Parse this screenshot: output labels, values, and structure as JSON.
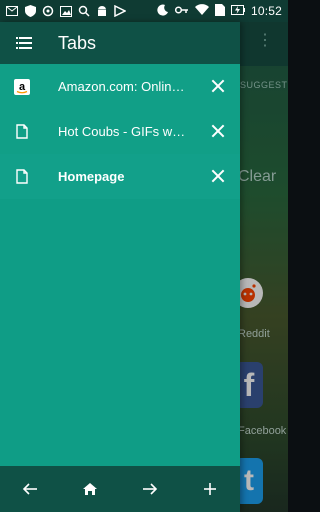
{
  "status_bar": {
    "time": "10:52",
    "icons": [
      "email-icon",
      "shield-icon",
      "sync-icon",
      "image-icon",
      "search-icon",
      "android-icon",
      "flag-icon",
      "moon-icon",
      "key-icon",
      "wifi-icon",
      "sim-icon",
      "battery-charging-icon"
    ]
  },
  "drawer": {
    "title": "Tabs",
    "tabs": [
      {
        "label": "Amazon.com: Online Shopping",
        "icon": "amazon-icon"
      },
      {
        "label": "Hot Coubs - GIFs with Sound",
        "icon": "page-icon"
      },
      {
        "label": "Homepage",
        "icon": "page-icon"
      }
    ],
    "bottom_bar": [
      "back-arrow-icon",
      "home-icon",
      "forward-arrow-icon",
      "plus-icon"
    ]
  },
  "background_page": {
    "suggested_label": "SUGGESTED FOR",
    "clear_label": "Clear",
    "reddit_label": "Reddit",
    "facebook_label": "Facebook",
    "fb_glyph": "f",
    "tw_glyph": "t"
  },
  "colors": {
    "drawer": "#0f9d86",
    "header": "#0f5146",
    "status": "#0f3b33"
  }
}
